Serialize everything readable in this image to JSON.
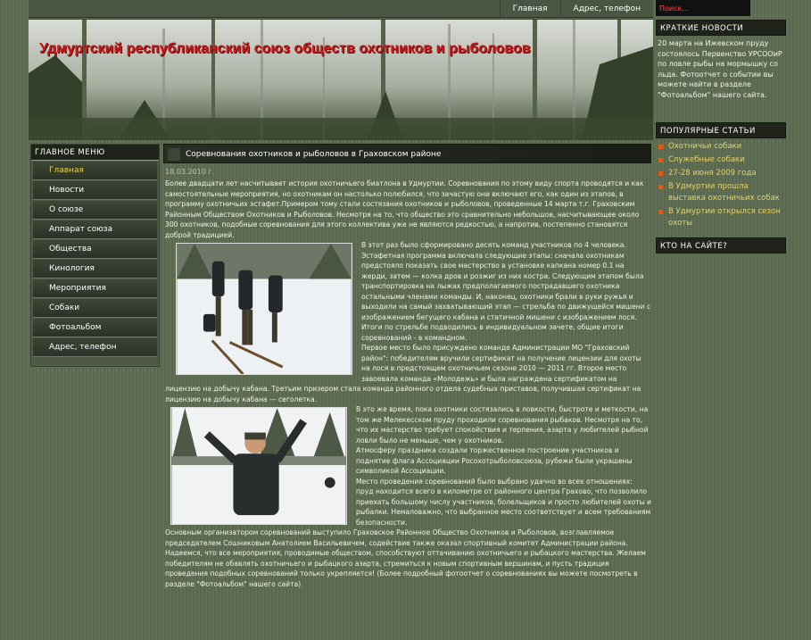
{
  "topnav": {
    "items": [
      "Главная",
      "Адрес, телефон"
    ]
  },
  "search": {
    "value": "Поиск..."
  },
  "header": {
    "title": "Удмуртский республиканский союз обществ охотников и рыболовов"
  },
  "main_menu": {
    "title": "ГЛАВНОЕ МЕНЮ",
    "items": [
      "Главная",
      "Новости",
      "О союзе",
      "Аппарат союза",
      "Общества",
      "Кинология",
      "Мероприятия",
      "Собаки",
      "Фотоальбом",
      "Адрес, телефон"
    ]
  },
  "article": {
    "title": "Соревнования охотников и рыболовов в Граховском районе",
    "date": "18.03.2010 г.",
    "p1": "Более двадцати лет насчитывает история охотничьего биатлона в Удмуртии. Соревнования по этому виду спорта проводятся и как самостоятельные мероприятия, но охотникам он настолько полюбился, что зачастую они включают его, как один из этапов, в программу охотничьих эстафет.Примером тому стали состязания охотников и рыболовов, проведенные 14 марта т.г. Граховским Районным Обществом Охотников и Рыболовов. Несмотря на то, что общество это сравнительно небольшое, насчитывающее около 300 охотников, подобные соревнования для этого коллектива уже не являются редкостью, а напротив, постепенно становятся доброй традицией.",
    "p2": "В этот раз было сформировано десять команд участников по 4 человека. Эстафетная программа включала следующие этапы: сначала охотникам предстояло показать свое мастерство в установке капкана номер 0.1 на жерди, затем — колка дров и розжиг из них костра. Следующим этапом была транспортировка на лыжах предполагаемого пострадавшего охотника остальными членами команды. И, наконец, охотники брали в руки ружья и выходили на самый захватывающий этап — стрельба по движущейся мишени с изображением бегущего кабана и статичной мишени с изображением лося. Итоги по стрельбе подводились в индивидуальном зачете, общие итоги соревнований - в командном.",
    "p3": "Первое место было присуждено команде Администрации МО \"Граховский район\": победителям вручили сертификат на получение лицензии для охоты на лося в предстоящем охотничьем сезоне 2010 — 2011 гг. Второе место завоевала команда «Молодежь» и была награждена сертификатом на лицензию на добычу кабана. Третьим призером стала команда районного отдела судебных приставов, получившая сертификат на лицензию на добычу кабана — сеголетка.",
    "p4": "В это же время, пока охотники состязались в ловкости, быстроте и меткости, на том же Мелекесском пруду проходили соревнования рыбаков. Несмотря на то, что их мастерство требует спокойствия и терпения, азарта у любителей рыбной ловли было не меньше, чем у охотников.",
    "p5": "Атмосферу праздника создали торжественное построение участников и поднятие флага Ассоциации Росохотрыболовсоюза, рубежи были украшены символикой Ассоциации.",
    "p6": "Место проведения соревнований было выбрано удачно во всех отношениях: пруд находится всего в километре от районного центра Грахово, что позволило приехать большому числу участников, болельщиков и просто любителей охоты и рыбалки. Немаловажно, что выбранное место соответствует и всем требованиям безопасности.",
    "p7": "Основным организатором соревнований выступило Граховское Районное Общество Охотников и Рыболовов, возглавляемое председателем Сошниковым Анатолием Васильевичем, содействие также оказал спортивный комитет Администрации района. Надеемся, что все мероприятия, проводимые обществом, способствуют оттачиванию охотничьего и рыбацкого мастерства. Желаем победителям не обавлять охотничьего и рыбацкого азарта, стремиться к новым спортивным вершинам, и пусть традиция проведения подобных соревнований только укрепляется! (Более подробный фотоотчет о соревнованиях вы можете посмотреть в разделе \"Фотоальбом\" нашего сайта)"
  },
  "short_news": {
    "title": "КРАТКИЕ НОВОСТИ",
    "text": "20 марта на Ижевском пруду состоялось Первенство УРСООиР по ловле рыбы на мормышку со льда. Фотоотчет о событии вы можете найти в разделе \"Фотоальбом\" нашего сайта."
  },
  "popular": {
    "title": "ПОПУЛЯРНЫЕ СТАТЬИ",
    "items": [
      "Охотничьи собаки",
      "Служебные собаки",
      "27-28 июня 2009 года",
      "В Удмуртии прошла выставка охотничьих собак",
      "В Удмуртии открылся сезон охоты"
    ]
  },
  "who_online": {
    "title": "КТО НА САЙТЕ?"
  },
  "colors": {
    "title_red": "#c81818",
    "link_yellow": "#e3d26a",
    "bullet_orange": "#e65a10",
    "search_red": "#ff4a4a"
  }
}
